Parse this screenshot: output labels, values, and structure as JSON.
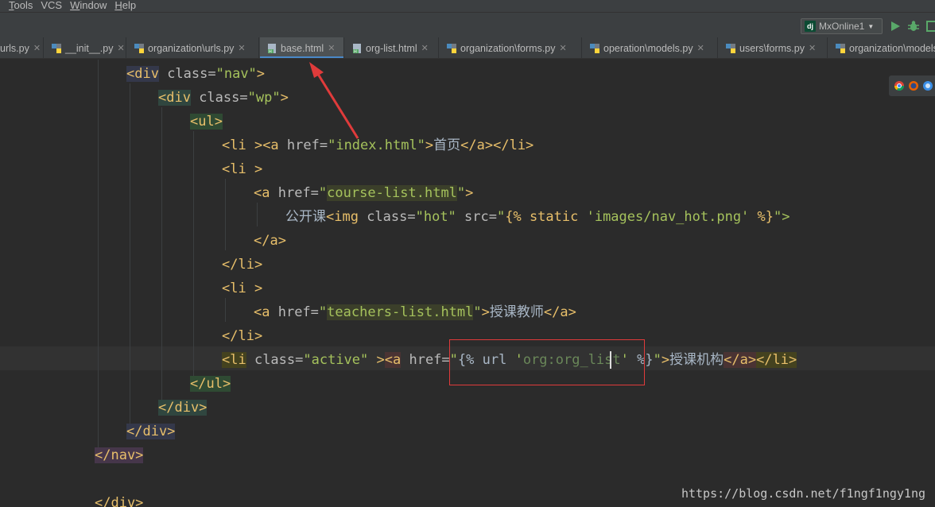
{
  "menu": {
    "items": [
      {
        "label": "Tools",
        "mnemonic": "T",
        "rest": "ools"
      },
      {
        "label": "VCS",
        "mnemonic": "",
        "rest": "VCS"
      },
      {
        "label": "Window",
        "mnemonic": "W",
        "rest": "indow"
      },
      {
        "label": "Help",
        "mnemonic": "H",
        "rest": "elp"
      }
    ]
  },
  "toolbar": {
    "run_config": "MxOnline1",
    "run_icon": "run-icon",
    "debug_icon": "debug-icon",
    "coverage_icon": "coverage-icon"
  },
  "tabs": [
    {
      "label": "urls.py",
      "icon": "python-file-icon"
    },
    {
      "label": "__init__.py",
      "icon": "python-file-icon"
    },
    {
      "label": "organization\\urls.py",
      "icon": "python-file-icon"
    },
    {
      "label": "base.html",
      "icon": "html-file-icon",
      "active": true
    },
    {
      "label": "org-list.html",
      "icon": "html-file-icon"
    },
    {
      "label": "organization\\forms.py",
      "icon": "python-file-icon"
    },
    {
      "label": "operation\\models.py",
      "icon": "python-file-icon"
    },
    {
      "label": "users\\forms.py",
      "icon": "python-file-icon"
    },
    {
      "label": "organization\\models.py",
      "icon": "python-file-icon"
    }
  ],
  "code": {
    "l1_tag_open": "<div",
    "l1_attr": " class=",
    "l1_val": "\"nav\"",
    "l1_close": ">",
    "l2_tag_open": "<div",
    "l2_attr": " class=",
    "l2_val": "\"wp\"",
    "l2_close": ">",
    "l3_tag": "<ul>",
    "l4_li": "<li >",
    "l4_a": "<a",
    "l4_attr": " href=",
    "l4_val": "\"index.html\"",
    "l4_close": ">",
    "l4_text": "首页",
    "l4_end": "</a></li>",
    "l5_li": "<li >",
    "l6_a": "<a",
    "l6_attr": " href=",
    "l6_q1": "\"",
    "l6_val": "course-list.html",
    "l6_q2": "\"",
    "l6_close": ">",
    "l7_text": "公开课",
    "l7_img": "<img",
    "l7_attr1": " class=",
    "l7_val1": "\"hot\"",
    "l7_attr2": " src=",
    "l7_q": "\"",
    "l7_dj1": "{% static ",
    "l7_str": "'images/nav_hot.png'",
    "l7_dj2": " %}",
    "l7_end": "\">",
    "l8_tag": "</a>",
    "l9_tag": "</li>",
    "l10_li": "<li >",
    "l11_a": "<a",
    "l11_attr": " href=",
    "l11_q1": "\"",
    "l11_val": "teachers-list.html",
    "l11_q2": "\"",
    "l11_close": ">",
    "l11_text": "授课教师",
    "l11_end": "</a>",
    "l12_tag": "</li>",
    "l13_li": "<li",
    "l13_attr": " class=",
    "l13_val": "\"active\"",
    "l13_close": " >",
    "l13_a": "<a",
    "l13_attr2": " href=",
    "l13_q1": "\"",
    "l13_dj1": "{% url ",
    "l13_str_q": "'",
    "l13_str": "org:org_list",
    "l13_str_q2": "'",
    "l13_dj2": " %}",
    "l13_q2": "\"",
    "l13_gt": ">",
    "l13_text": "授课机构",
    "l13_a_end": "</a>",
    "l13_li_end": "</li>",
    "l14_tag": "</ul>",
    "l15_tag": "</div>",
    "l16_tag": "</div>",
    "l17_tag": "</nav>",
    "l19_tag": "</div>"
  },
  "watermark": "https://blog.csdn.net/f1ngf1ngy1ng"
}
